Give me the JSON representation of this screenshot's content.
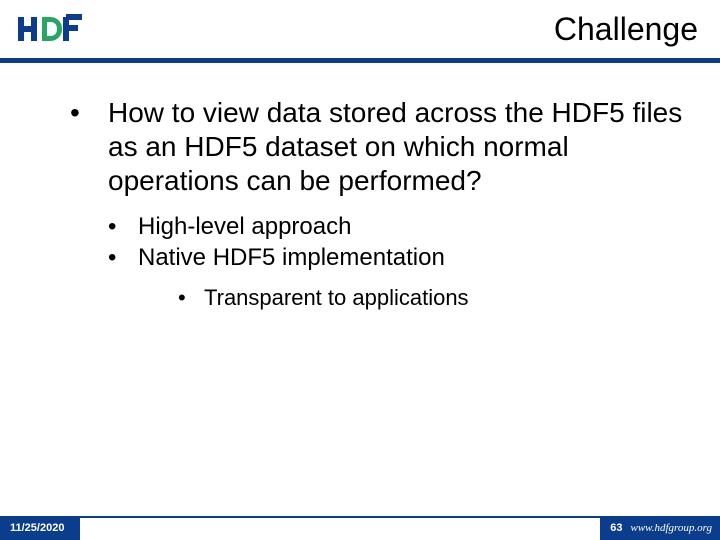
{
  "header": {
    "title": "Challenge",
    "logo_alt": "HDF"
  },
  "bullets": {
    "l1": "How to view data stored across the HDF5 files as an HDF5 dataset on which normal operations can be performed?",
    "l2a": "High-level approach",
    "l2b": "Native HDF5 implementation",
    "l3": "Transparent to applications"
  },
  "footer": {
    "date": "11/25/2020",
    "page": "63",
    "url": "www.hdfgroup.org"
  },
  "colors": {
    "accent": "#0a3d8c"
  }
}
